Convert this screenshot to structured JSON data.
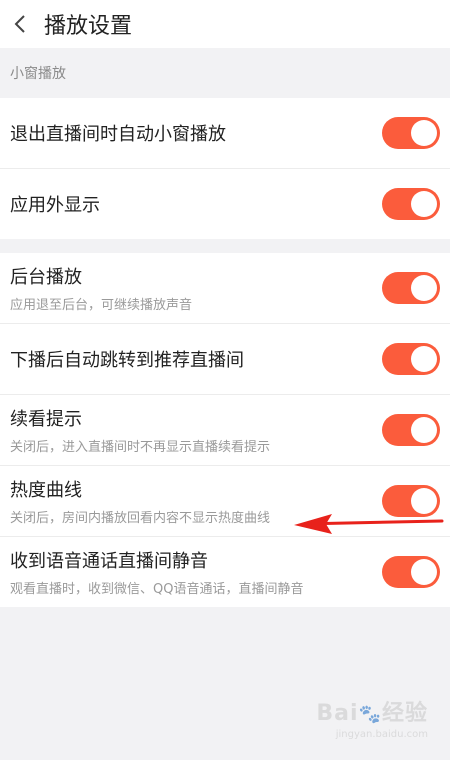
{
  "header": {
    "title": "播放设置"
  },
  "section1": {
    "label": "小窗播放",
    "items": [
      {
        "main": "退出直播间时自动小窗播放",
        "on": true
      },
      {
        "main": "应用外显示",
        "on": true
      }
    ]
  },
  "section2": {
    "items": [
      {
        "main": "后台播放",
        "sub": "应用退至后台，可继续播放声音",
        "on": true
      },
      {
        "main": "下播后自动跳转到推荐直播间",
        "on": true
      },
      {
        "main": "续看提示",
        "sub": "关闭后，进入直播间时不再显示直播续看提示",
        "on": true
      },
      {
        "main": "热度曲线",
        "sub": "关闭后，房间内播放回看内容不显示热度曲线",
        "on": true
      },
      {
        "main": "收到语音通话直播间静音",
        "sub": "观看直播时，收到微信、QQ语音通话，直播间静音",
        "on": true
      }
    ]
  },
  "colors": {
    "toggle_on": "#fb5c3c",
    "arrow": "#e8221b"
  },
  "watermark": {
    "brand": "Bai",
    "brand_cn": "经验",
    "url": "jingyan.baidu.com"
  }
}
